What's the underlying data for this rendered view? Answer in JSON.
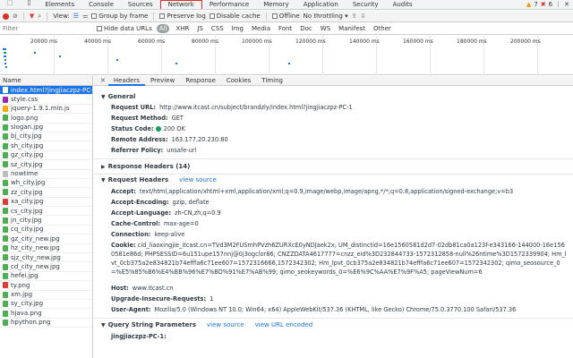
{
  "tabs": [
    "Elements",
    "Console",
    "Sources",
    "Network",
    "Performance",
    "Memory",
    "Application",
    "Security",
    "Audits"
  ],
  "counters": {
    "warnings": "7",
    "errors": "6"
  },
  "toolbar": {
    "view_label": "View:",
    "group_by_frame": "Group by frame",
    "preserve_log": "Preserve log",
    "disable_cache": "Disable cache",
    "offline": "Offline",
    "throttling": "No throttling"
  },
  "filter": {
    "placeholder": "Filter",
    "hide_data_urls": "Hide data URLs",
    "types": [
      "All",
      "XHR",
      "JS",
      "CSS",
      "Img",
      "Media",
      "Font",
      "Doc",
      "WS",
      "Manifest",
      "Other"
    ]
  },
  "timeline": {
    "ticks": [
      "20000 ms",
      "40000 ms",
      "60000 ms",
      "80000 ms",
      "100000 ms",
      "120000 ms",
      "140000 ms",
      "160000 ms",
      "180000 ms",
      "200000 ms"
    ]
  },
  "left": {
    "header": "Name",
    "files": [
      "index.html?jingjiaczpz-PC-1",
      "style.css",
      "jquery-1.9.1.min.js",
      "logo.png",
      "slogan.jpg",
      "bj_city.jpg",
      "sh_city.jpg",
      "gz_city.jpg",
      "sz_city.jpg",
      "nowtime",
      "wh_city.jpg",
      "zz_city.jpg",
      "xa_city.jpg",
      "cs_city.jpg",
      "jn_city.jpg",
      "cq_city.jpg",
      "gz_city_new.jpg",
      "hz_city_new.jpg",
      "sjz_city_new.jpg",
      "cd_city_new.jpg",
      "hefei.jpg",
      "ty.png",
      "xm.jpg",
      "sy_city.jpg",
      "hjava.png",
      "hpython.png"
    ]
  },
  "detail": {
    "tabs": [
      "Headers",
      "Preview",
      "Response",
      "Cookies",
      "Timing"
    ],
    "general": {
      "title": "General",
      "request_url_k": "Request URL:",
      "request_url_v": "http://www.itcast.cn/subject/brandzly/index.html?jingjiaczpz-PC-1",
      "method_k": "Request Method:",
      "method_v": "GET",
      "status_k": "Status Code:",
      "status_v": "200 OK",
      "remote_k": "Remote Address:",
      "remote_v": "163.177.20.230:80",
      "referrer_k": "Referrer Policy:",
      "referrer_v": "unsafe-url"
    },
    "response_headers": "Response Headers (14)",
    "request_headers": {
      "title": "Request Headers",
      "view_source": "view source",
      "accept_k": "Accept:",
      "accept_v": "text/html,application/xhtml+xml,application/xml;q=0.9,image/webp,image/apng,*/*;q=0.8,application/signed-exchange;v=b3",
      "enc_k": "Accept-Encoding:",
      "enc_v": "gzip, deflate",
      "lang_k": "Accept-Language:",
      "lang_v": "zh-CN,zh;q=0.9",
      "cache_k": "Cache-Control:",
      "cache_v": "max-age=0",
      "conn_k": "Connection:",
      "conn_v": "keep-alive",
      "cookie_k": "Cookie:",
      "cookie_v": "cid_liaoxingjie_itcast.cn=TVd3M2FUSmhPVzh6ZURXcE0yNDJaek2x; UM_distinctid=16e1560581d2d7-02db81ca0a123f-e343166-144000-16e1560581e86d; PHPSESSID=6u151upe157nnj@0j3ogclor86; CNZZDATA4617777=cnzz_eid%3D232844733-1572312858-null%26ntime%3D1572339904; Hm_lvt_0cb375a2e834821b74efffa6c71ee607=1572316666,1572342302; Hm_lpvt_0cb375a2e834821b74efffa6c71ee607=1572342302; qimo_seosource_0=%E5%85%B6%E4%BB%96%E7%BD%91%E7%AB%99; qimo_seokeywords_0=%E6%9C%AA%E7%9F%A5; pageViewNum=6",
      "host_k": "Host:",
      "host_v": "www.itcast.cn",
      "upg_k": "Upgrade-Insecure-Requests:",
      "upg_v": "1",
      "ua_k": "User-Agent:",
      "ua_v": "Mozilla/5.0 (Windows NT 10.0; Win64; x64) AppleWebKit/537.36 (KHTML, like Gecko) Chrome/75.0.3770.100 Safari/537.36"
    },
    "qsp": {
      "title": "Query String Parameters",
      "view_source": "view source",
      "view_url_encoded": "view URL encoded",
      "param_k": "jingjiaczpz-PC-1:",
      "param_v": ""
    }
  },
  "colors": {
    "accent": "#1a73e8",
    "network_tab_outline": "#e0312d",
    "status_ok": "#0f9d58"
  }
}
